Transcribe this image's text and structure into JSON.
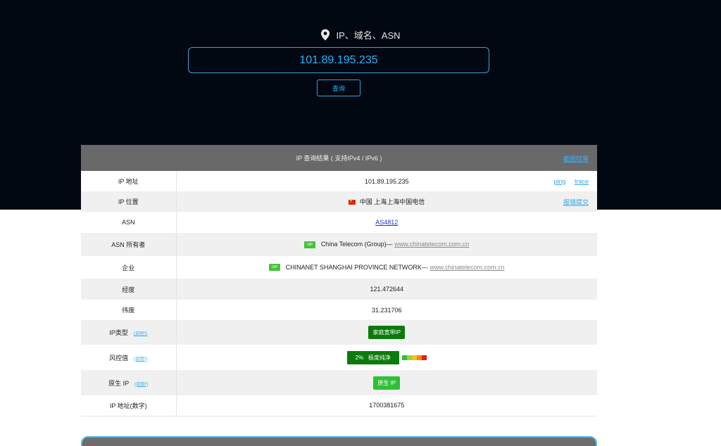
{
  "search": {
    "label": "IP、域名、ASN",
    "value": "101.89.195.235",
    "button": "查询"
  },
  "result": {
    "title": "IP 查询结果 ( 支持IPv4 / IPv6 )",
    "screenshot_link": "截图结果",
    "rows": {
      "ip": {
        "label": "IP 地址",
        "value": "101.89.195.235",
        "ping": "ping",
        "trace": "trace"
      },
      "location": {
        "label": "IP 位置",
        "value": "中国 上海上海中国电信",
        "report": "报错提交"
      },
      "asn": {
        "label": "ASN",
        "value": "AS4812"
      },
      "asn_owner": {
        "label": "ASN 所有者",
        "badge": "ISP",
        "name": "China Telecom (Group)—",
        "site": "www.chinatelecom.com.cn"
      },
      "company": {
        "label": "企业",
        "badge": "ISP",
        "name": "CHINANET SHANGHAI PROVINCE NETWORK—",
        "site": "www.chinatelecom.com.cn"
      },
      "longitude": {
        "label": "经度",
        "value": "121.472644"
      },
      "latitude": {
        "label": "纬度",
        "value": "31.231706"
      },
      "ip_type": {
        "label": "IP类型",
        "hint": "(说明?)",
        "value": "家庭宽带IP"
      },
      "risk": {
        "label": "风控值",
        "hint": "(说明?)",
        "value": "2%   极度纯净"
      },
      "native": {
        "label": "原生 IP",
        "hint": "(说明?)",
        "value": "原生 IP"
      },
      "ip_numeric": {
        "label": "IP 地址(数字)",
        "value": "1700381675"
      }
    }
  },
  "colors": {
    "hero_bg": "#010812",
    "accent": "#22b6ff",
    "risk_scale": [
      "#2ec133",
      "#9bd33a",
      "#f0c419",
      "#f08a19",
      "#e81b1b"
    ]
  }
}
